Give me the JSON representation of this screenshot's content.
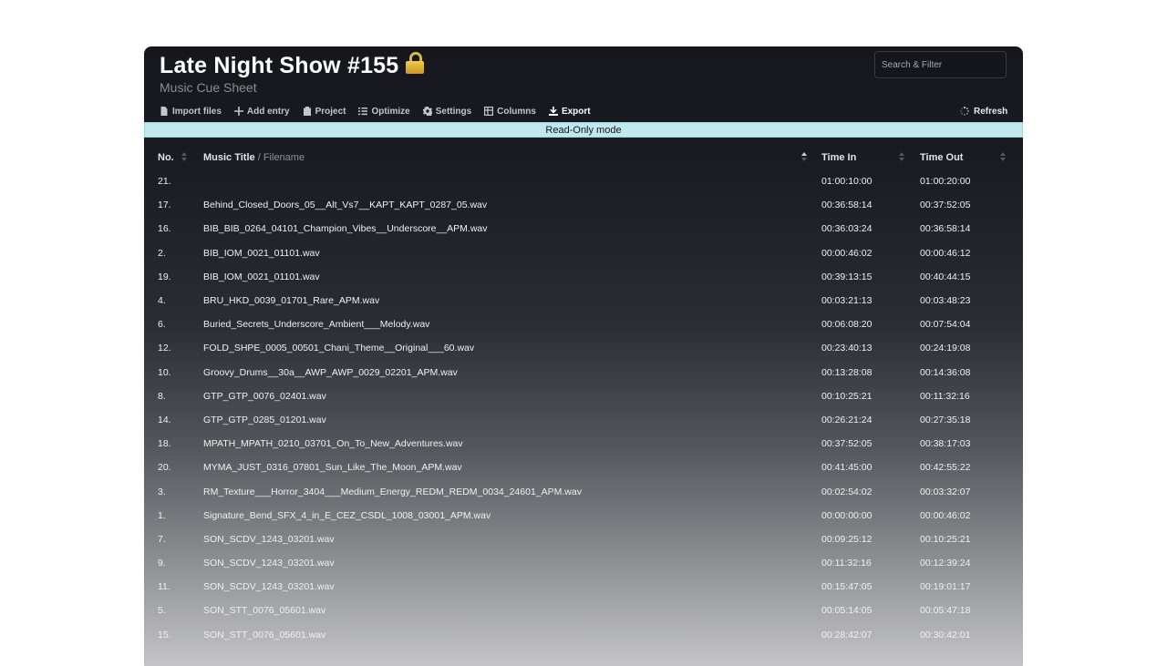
{
  "header": {
    "title": "Late Night Show #155",
    "lock_icon": "lock-icon",
    "subtitle": "Music Cue Sheet",
    "search_placeholder": "Search & Filter"
  },
  "toolbar": {
    "import": "Import files",
    "add": "Add entry",
    "project": "Project",
    "optimize": "Optimize",
    "settings": "Settings",
    "columns": "Columns",
    "export": "Export",
    "refresh": "Refresh"
  },
  "banner": "Read-Only mode",
  "table": {
    "headers": {
      "no": "No.",
      "title": "Music Title",
      "title_sub": "/ Filename",
      "time_in": "Time In",
      "time_out": "Time Out"
    },
    "rows": [
      {
        "no": "21.",
        "title": "",
        "in": "01:00:10:00",
        "out": "01:00:20:00"
      },
      {
        "no": "17.",
        "title": "Behind_Closed_Doors_05__Alt_Vs7__KAPT_KAPT_0287_05.wav",
        "in": "00:36:58:14",
        "out": "00:37:52:05"
      },
      {
        "no": "16.",
        "title": "BIB_BIB_0264_04101_Champion_Vibes__Underscore__APM.wav",
        "in": "00:36:03:24",
        "out": "00:36:58:14"
      },
      {
        "no": "2.",
        "title": "BIB_IOM_0021_01101.wav",
        "in": "00:00:46:02",
        "out": "00:00:46:12"
      },
      {
        "no": "19.",
        "title": "BIB_IOM_0021_01101.wav",
        "in": "00:39:13:15",
        "out": "00:40:44:15"
      },
      {
        "no": "4.",
        "title": "BRU_HKD_0039_01701_Rare_APM.wav",
        "in": "00:03:21:13",
        "out": "00:03:48:23"
      },
      {
        "no": "6.",
        "title": "Buried_Secrets_Underscore_Ambient___Melody.wav",
        "in": "00:06:08:20",
        "out": "00:07:54:04"
      },
      {
        "no": "12.",
        "title": "FOLD_SHPE_0005_00501_Chani_Theme__Original___60.wav",
        "in": "00:23:40:13",
        "out": "00:24:19:08"
      },
      {
        "no": "10.",
        "title": "Groovy_Drums__30a__AWP_AWP_0029_02201_APM.wav",
        "in": "00:13:28:08",
        "out": "00:14:36:08"
      },
      {
        "no": "8.",
        "title": "GTP_GTP_0076_02401.wav",
        "in": "00:10:25:21",
        "out": "00:11:32:16"
      },
      {
        "no": "14.",
        "title": "GTP_GTP_0285_01201.wav",
        "in": "00:26:21:24",
        "out": "00:27:35:18"
      },
      {
        "no": "18.",
        "title": "MPATH_MPATH_0210_03701_On_To_New_Adventures.wav",
        "in": "00:37:52:05",
        "out": "00:38:17:03"
      },
      {
        "no": "20.",
        "title": "MYMA_JUST_0316_07801_Sun_Like_The_Moon_APM.wav",
        "in": "00:41:45:00",
        "out": "00:42:55:22"
      },
      {
        "no": "3.",
        "title": "RM_Texture___Horror_3404___Medium_Energy_REDM_REDM_0034_24601_APM.wav",
        "in": "00:02:54:02",
        "out": "00:03:32:07"
      },
      {
        "no": "1.",
        "title": "Signature_Bend_SFX_4_in_E_CEZ_CSDL_1008_03001_APM.wav",
        "in": "00:00:00:00",
        "out": "00:00:46:02"
      },
      {
        "no": "7.",
        "title": "SON_SCDV_1243_03201.wav",
        "in": "00:09:25:12",
        "out": "00:10:25:21"
      },
      {
        "no": "9.",
        "title": "SON_SCDV_1243_03201.wav",
        "in": "00:11:32:16",
        "out": "00:12:39:24"
      },
      {
        "no": "11.",
        "title": "SON_SCDV_1243_03201.wav",
        "in": "00:15:47:05",
        "out": "00:19:01:17"
      },
      {
        "no": "5.",
        "title": "SON_STT_0076_05601.wav",
        "in": "00:05:14:05",
        "out": "00:05:47:18"
      },
      {
        "no": "15.",
        "title": "SON_STT_0076_05601.wav",
        "in": "00:28:42:07",
        "out": "00:30:42:01"
      }
    ]
  }
}
